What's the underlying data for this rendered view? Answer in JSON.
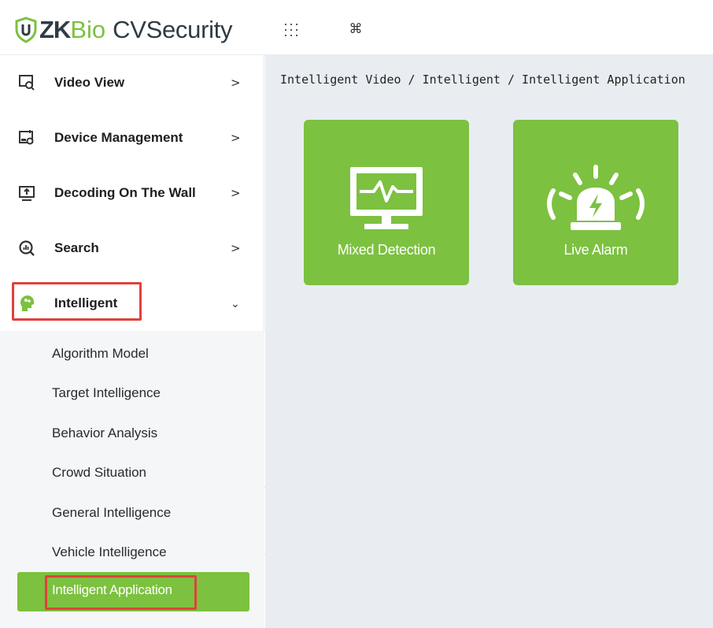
{
  "header": {
    "logo_zk": "ZK",
    "logo_bio": "Bio",
    "logo_cv": "CVSecurity",
    "apps_icon": "grid-dots-icon",
    "shortcut_icon": "⌘"
  },
  "sidebar": {
    "items": [
      {
        "label": "Video View",
        "icon": "video-view-icon",
        "chevron": ">"
      },
      {
        "label": "Device Management",
        "icon": "device-management-icon",
        "chevron": ">"
      },
      {
        "label": "Decoding On The Wall",
        "icon": "decoding-wall-icon",
        "chevron": ">"
      },
      {
        "label": "Search",
        "icon": "search-icon",
        "chevron": ">"
      },
      {
        "label": "Intelligent",
        "icon": "intelligent-icon",
        "chevron": "⌄"
      }
    ],
    "sub_items": [
      {
        "label": "Algorithm Model"
      },
      {
        "label": "Target Intelligence"
      },
      {
        "label": "Behavior Analysis"
      },
      {
        "label": "Crowd Situation"
      },
      {
        "label": "General Intelligence"
      },
      {
        "label": "Vehicle Intelligence"
      },
      {
        "label": "Intelligent Application"
      }
    ],
    "collapse_label": "«"
  },
  "main": {
    "breadcrumb": "Intelligent Video / Intelligent / Intelligent Application",
    "tiles": [
      {
        "label": "Mixed Detection",
        "icon": "monitor-pulse-icon"
      },
      {
        "label": "Live Alarm",
        "icon": "alarm-light-icon"
      }
    ]
  },
  "colors": {
    "accent": "#7cc140",
    "highlight": "#e0413b",
    "content_bg": "#e9edf2",
    "submenu_bg": "#f4f6f8"
  }
}
